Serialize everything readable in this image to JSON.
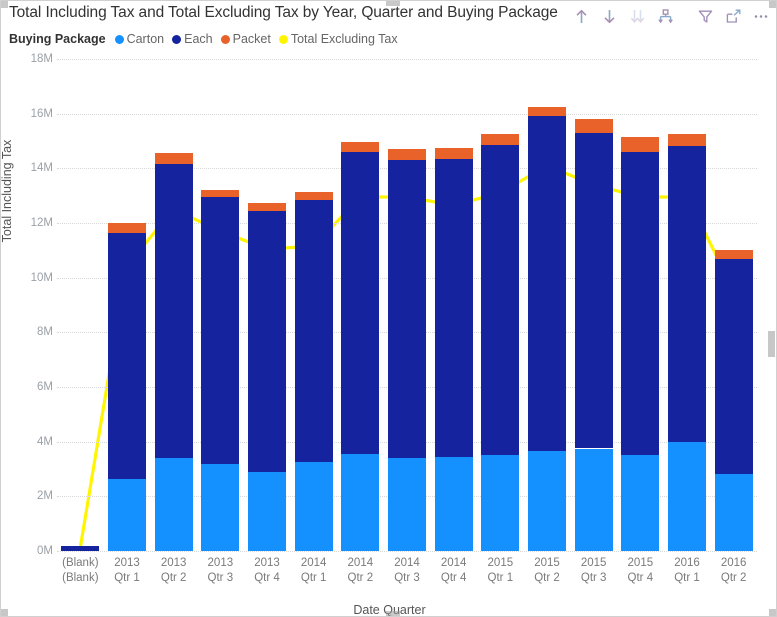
{
  "header": {
    "title": "Total Including Tax and Total Excluding Tax by Year, Quarter and Buying Package",
    "toolbar": [
      {
        "name": "drill-up-icon",
        "label": "Drill up",
        "enabled": true
      },
      {
        "name": "drill-down-icon",
        "label": "Drill down",
        "enabled": true
      },
      {
        "name": "expand-all-down-icon",
        "label": "Expand all down",
        "enabled": false
      },
      {
        "name": "drill-hierarchy-icon",
        "label": "Go to next level",
        "enabled": true
      },
      {
        "name": "filter-icon",
        "label": "Filters",
        "enabled": true
      },
      {
        "name": "focus-mode-icon",
        "label": "Focus mode",
        "enabled": true
      },
      {
        "name": "more-options-icon",
        "label": "More options",
        "enabled": true
      }
    ]
  },
  "legend": {
    "title": "Buying Package",
    "items": [
      {
        "label": "Carton",
        "color": "#1490FF"
      },
      {
        "label": "Each",
        "color": "#15239E"
      },
      {
        "label": "Packet",
        "color": "#E8622A"
      },
      {
        "label": "Total Excluding Tax",
        "color": "#FFF500"
      }
    ]
  },
  "axes": {
    "y_title": "Total Including Tax",
    "x_title": "Date Quarter",
    "y_ticks": [
      "0M",
      "2M",
      "4M",
      "6M",
      "8M",
      "10M",
      "12M",
      "14M",
      "16M",
      "18M"
    ]
  },
  "chart_data": {
    "type": "bar",
    "title": "Total Including Tax and Total Excluding Tax by Year, Quarter and Buying Package",
    "xlabel": "Date Quarter",
    "ylabel": "Total Including Tax",
    "ylim": [
      0,
      18000000
    ],
    "ytick_values": [
      0,
      2000000,
      4000000,
      6000000,
      8000000,
      10000000,
      12000000,
      14000000,
      16000000,
      18000000
    ],
    "grid": true,
    "legend_position": "top-left",
    "stacked": true,
    "categories": [
      "(Blank) (Blank)",
      "2013 Qtr 1",
      "2013 Qtr 2",
      "2013 Qtr 3",
      "2013 Qtr 4",
      "2014 Qtr 1",
      "2014 Qtr 2",
      "2014 Qtr 3",
      "2014 Qtr 4",
      "2015 Qtr 1",
      "2015 Qtr 2",
      "2015 Qtr 3",
      "2015 Qtr 4",
      "2016 Qtr 1",
      "2016 Qtr 2"
    ],
    "category_lines": [
      [
        "(Blank)",
        "(Blank)"
      ],
      [
        "2013",
        "Qtr 1"
      ],
      [
        "2013",
        "Qtr 2"
      ],
      [
        "2013",
        "Qtr 3"
      ],
      [
        "2013",
        "Qtr 4"
      ],
      [
        "2014",
        "Qtr 1"
      ],
      [
        "2014",
        "Qtr 2"
      ],
      [
        "2014",
        "Qtr 3"
      ],
      [
        "2014",
        "Qtr 4"
      ],
      [
        "2015",
        "Qtr 1"
      ],
      [
        "2015",
        "Qtr 2"
      ],
      [
        "2015",
        "Qtr 3"
      ],
      [
        "2015",
        "Qtr 4"
      ],
      [
        "2016",
        "Qtr 1"
      ],
      [
        "2016",
        "Qtr 2"
      ]
    ],
    "series": [
      {
        "name": "Carton",
        "color": "#1490FF",
        "type": "bar",
        "values": [
          0,
          2650000,
          3400000,
          3200000,
          2900000,
          3250000,
          3550000,
          3400000,
          3450000,
          3500000,
          3650000,
          3750000,
          3500000,
          4000000,
          2800000
        ]
      },
      {
        "name": "Each",
        "color": "#15239E",
        "type": "bar",
        "values": [
          170000,
          9000000,
          10750000,
          9750000,
          9550000,
          9600000,
          11050000,
          10900000,
          10900000,
          11350000,
          12250000,
          11550000,
          11100000,
          10800000,
          7900000
        ]
      },
      {
        "name": "Packet",
        "color": "#E8622A",
        "type": "bar",
        "values": [
          0,
          350000,
          400000,
          250000,
          300000,
          300000,
          350000,
          400000,
          400000,
          400000,
          350000,
          500000,
          550000,
          450000,
          300000
        ]
      },
      {
        "name": "Total Excluding Tax",
        "color": "#FFF500",
        "type": "line",
        "values": [
          130000,
          10450000,
          12500000,
          11700000,
          11050000,
          11150000,
          12950000,
          12950000,
          12650000,
          13100000,
          14100000,
          13400000,
          12950000,
          12950000,
          9550000
        ]
      }
    ],
    "stack_totals": [
      170000,
      12000000,
      14550000,
      13200000,
      12750000,
      13150000,
      14950000,
      14700000,
      14750000,
      15250000,
      16250000,
      15800000,
      15150000,
      15250000,
      11000000
    ]
  }
}
